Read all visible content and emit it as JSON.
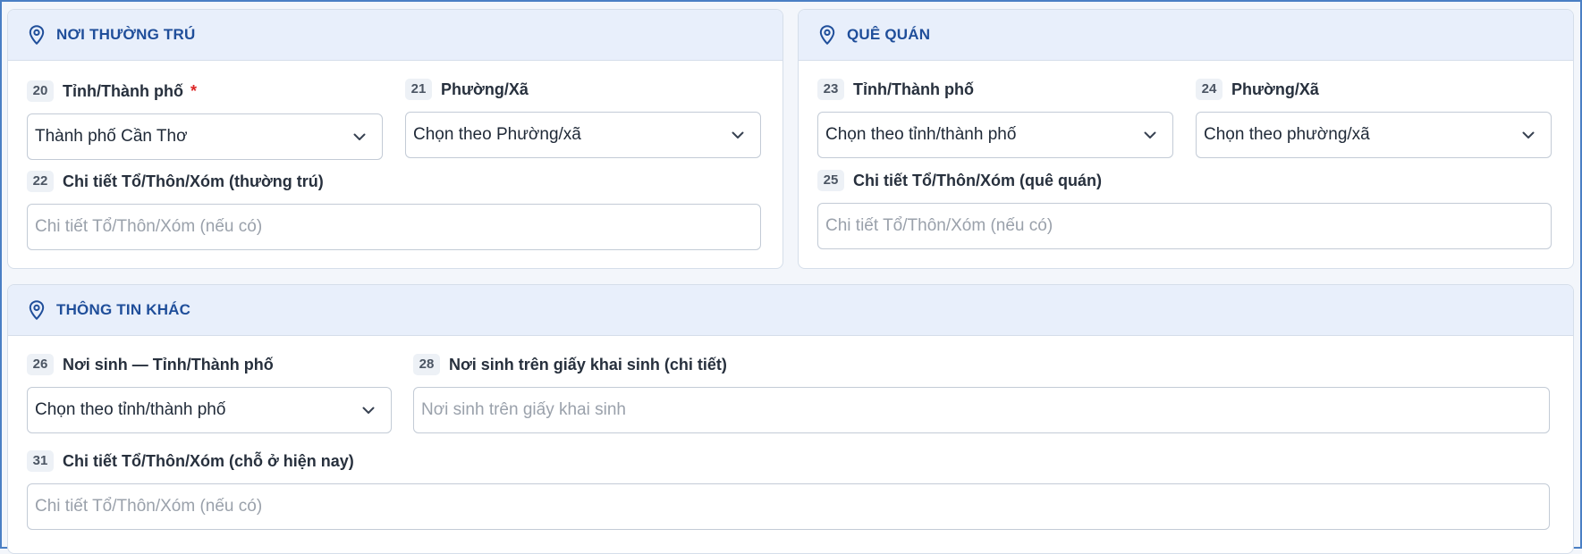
{
  "permanent": {
    "title": "NƠI THƯỜNG TRÚ",
    "province": {
      "num": "20",
      "label": "Tỉnh/Thành phố",
      "required_mark": "*",
      "value": "Thành phố Cần Thơ"
    },
    "ward": {
      "num": "21",
      "label": "Phường/Xã",
      "value": "Chọn theo Phường/xã"
    },
    "detail": {
      "num": "22",
      "label": "Chi tiết Tổ/Thôn/Xóm (thường trú)",
      "placeholder": "Chi tiết Tổ/Thôn/Xóm (nếu có)"
    }
  },
  "hometown": {
    "title": "QUÊ QUÁN",
    "province": {
      "num": "23",
      "label": "Tỉnh/Thành phố",
      "value": "Chọn theo tỉnh/thành phố"
    },
    "ward": {
      "num": "24",
      "label": "Phường/Xã",
      "value": "Chọn theo phường/xã"
    },
    "detail": {
      "num": "25",
      "label": "Chi tiết Tổ/Thôn/Xóm (quê quán)",
      "placeholder": "Chi tiết Tổ/Thôn/Xóm (nếu có)"
    }
  },
  "other": {
    "title": "THÔNG TIN KHÁC",
    "birth_province": {
      "num": "26",
      "label": "Nơi sinh — Tỉnh/Thành phố",
      "value": "Chọn theo tỉnh/thành phố"
    },
    "birth_detail": {
      "num": "28",
      "label": "Nơi sinh trên giấy khai sinh (chi tiết)",
      "placeholder": "Nơi sinh trên giấy khai sinh"
    },
    "current_detail": {
      "num": "31",
      "label": "Chi tiết Tổ/Thôn/Xóm (chỗ ở hiện nay)",
      "placeholder": "Chi tiết Tổ/Thôn/Xóm (nếu có)"
    }
  },
  "icons": {
    "section": "map-pin-icon",
    "dropdown": "chevron-down-icon"
  },
  "colors": {
    "accent": "#1f4e9a",
    "header_bg": "#e8effb",
    "required": "#dc2626",
    "frame": "#4a7fc4"
  }
}
